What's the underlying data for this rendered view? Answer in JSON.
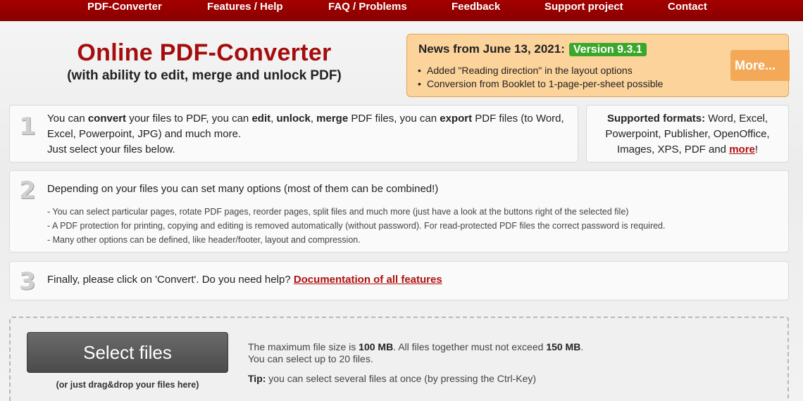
{
  "nav": {
    "items": [
      "PDF-Converter",
      "Features / Help",
      "FAQ / Problems",
      "Feedback",
      "Support project",
      "Contact"
    ]
  },
  "header": {
    "title": "Online PDF-Converter",
    "subtitle": "(with ability to edit, merge and unlock PDF)"
  },
  "news": {
    "title": "News from June 13, 2021:",
    "version": "Version 9.3.1",
    "items": [
      "Added \"Reading direction\" in the layout options",
      "Conversion from Booklet to 1-page-per-sheet possible"
    ],
    "more_label": "More..."
  },
  "step1": {
    "number": "1",
    "t1": "You can ",
    "k1": "convert",
    "t2": " your files to PDF, you can ",
    "k2": "edit",
    "t3": ", ",
    "k3": "unlock",
    "t4": ", ",
    "k4": "merge",
    "t5": " PDF files, you can ",
    "k5": "export",
    "t6": " PDF files (to Word, Excel, Powerpoint, JPG) and much more.",
    "line2": "Just select your files below.",
    "formats_label": "Supported formats:",
    "formats_text": " Word, Excel, Powerpoint, Publisher, OpenOffice, Images, XPS, PDF and ",
    "formats_more": "more",
    "formats_end": "!"
  },
  "step2": {
    "number": "2",
    "heading": "Depending on your files you can set many options (most of them can be combined!)",
    "items": [
      "- You can select particular pages, rotate PDF pages, reorder pages, split files and much more (just have a look at the buttons right of the selected file)",
      "- A PDF protection for printing, copying and editing is removed automatically (without password). For read-protected PDF files the correct password is required.",
      "- Many other options can be defined, like header/footer, layout and compression."
    ]
  },
  "step3": {
    "number": "3",
    "text": "Finally, please click on 'Convert'. Do you need help? ",
    "link": "Documentation of all features"
  },
  "upload": {
    "button_label": "Select files",
    "drag_hint": "(or just drag&drop your files here)",
    "limit_t1": "The maximum file size is ",
    "limit_k1": "100 MB",
    "limit_t2": ". All files together must not exceed ",
    "limit_k2": "150 MB",
    "limit_t3": ".",
    "limit_line2": "You can select up to 20 files.",
    "tip_label": "Tip:",
    "tip_text": " you can select several files at once (by pressing the Ctrl-Key)"
  },
  "colors": {
    "nav_bg": "#a40000",
    "title_red": "#a50d0d",
    "news_bg": "#fcd39b",
    "version_green": "#3aa72a",
    "more_orange": "#f3a957"
  }
}
